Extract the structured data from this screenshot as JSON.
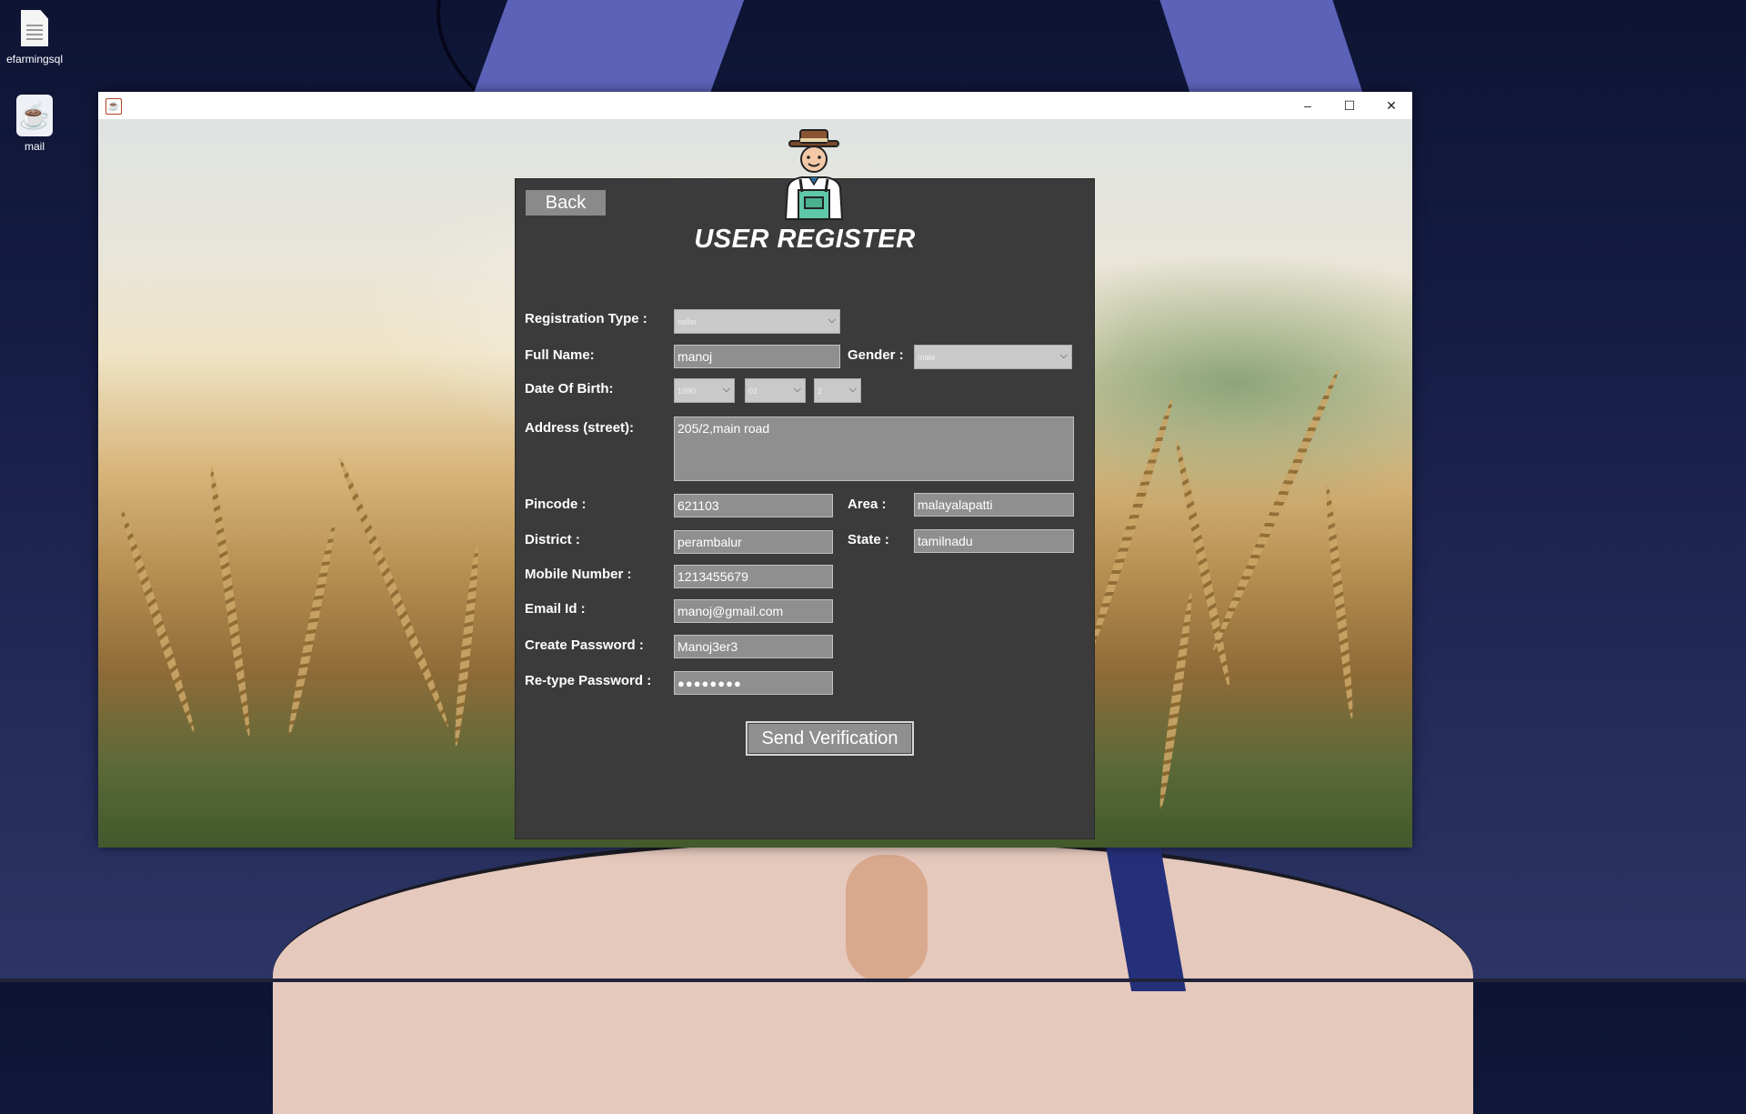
{
  "desktop": {
    "icons": [
      {
        "label": "efarmingsql",
        "icon": "text-file-icon"
      },
      {
        "label": "mail",
        "icon": "java-app-icon"
      }
    ]
  },
  "window": {
    "title_icon": "java-cup-icon",
    "controls": {
      "minimize": "–",
      "maximize": "☐",
      "close": "✕"
    }
  },
  "form": {
    "back_label": "Back",
    "title": "USER REGISTER",
    "registration_type": {
      "label": "Registration Type :",
      "value": "seller"
    },
    "full_name": {
      "label": "Full Name:",
      "value": "manoj"
    },
    "gender": {
      "label": "Gender :",
      "value": "male"
    },
    "dob": {
      "label": "Date Of Birth:",
      "year": "1990",
      "month": "02",
      "day": "2"
    },
    "address": {
      "label": "Address (street):",
      "value": "205/2,main road"
    },
    "pincode": {
      "label": "Pincode :",
      "value": "621103"
    },
    "area": {
      "label": "Area :",
      "value": "malayalapatti"
    },
    "district": {
      "label": "District :",
      "value": "perambalur"
    },
    "state": {
      "label": "State :",
      "value": "tamilnadu"
    },
    "mobile": {
      "label": "Mobile Number :",
      "value": "1213455679"
    },
    "email": {
      "label": "Email Id :",
      "value": "manoj@gmail.com"
    },
    "create_password": {
      "label": "Create Password :",
      "value": "Manoj3er3"
    },
    "retype_password": {
      "label": "Re-type Password :",
      "value": "●●●●●●●●"
    },
    "send_label": "Send Verification"
  }
}
